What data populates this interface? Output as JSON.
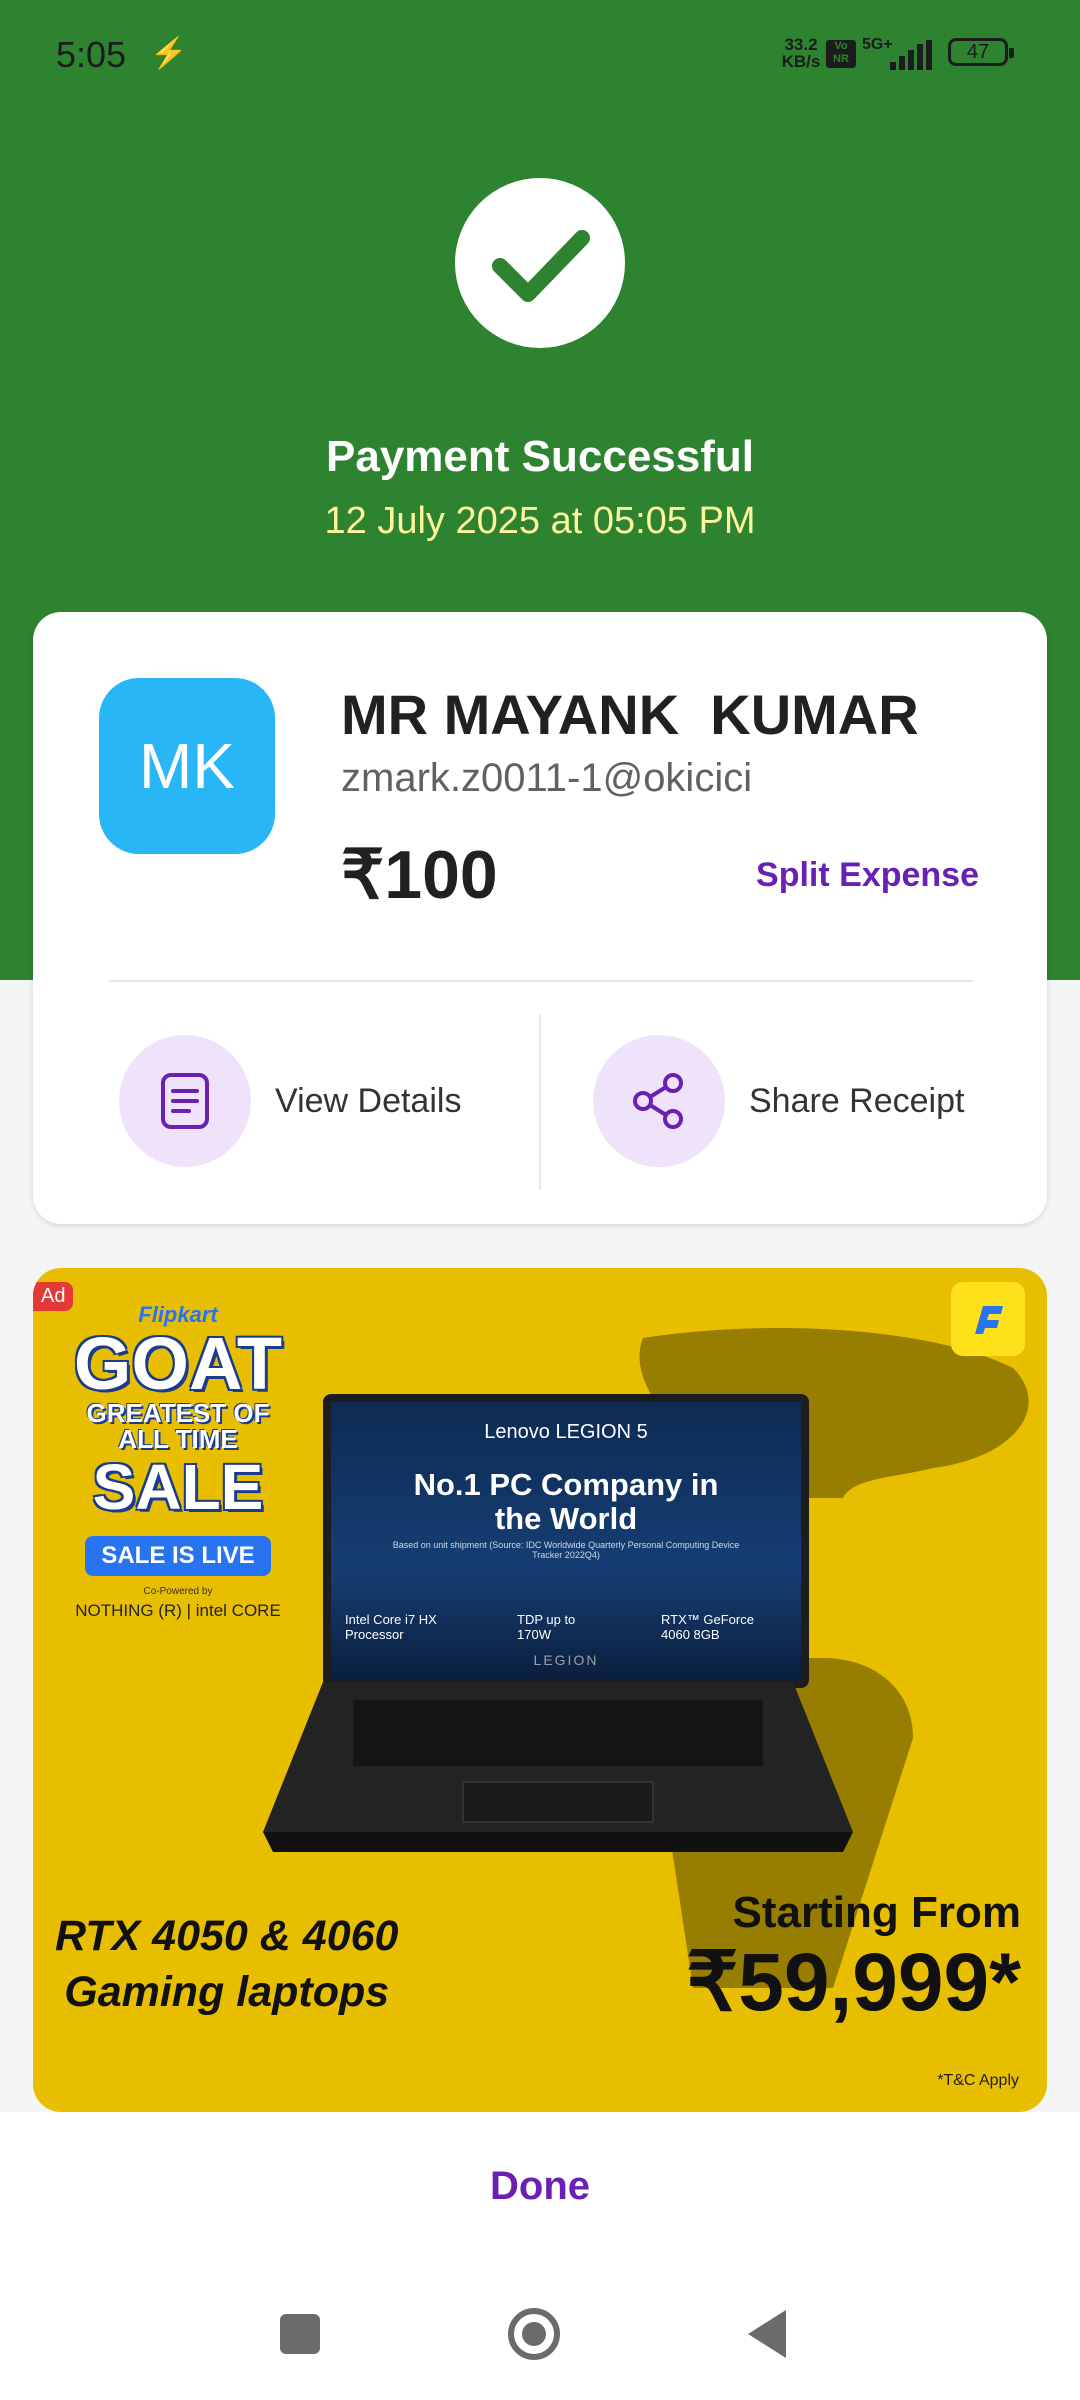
{
  "status_bar": {
    "time": "5:05",
    "network_speed": "33.2 KB/s",
    "volte": "Vo NR",
    "network_type": "5G+",
    "battery": "47",
    "icons": [
      "flash-icon",
      "signal-icon",
      "battery-icon"
    ]
  },
  "payment": {
    "title": "Payment Successful",
    "datetime": "12 July 2025 at 05:05 PM",
    "status_icon": "check-icon"
  },
  "recipient": {
    "initials": "MK",
    "name": "MR MAYANK  KUMAR",
    "upi_id": "zmark.z0011-1@okicici",
    "amount": "₹100",
    "split_label": "Split Expense"
  },
  "actions": [
    {
      "label": "View Details",
      "icon": "document-icon"
    },
    {
      "label": "Share Receipt",
      "icon": "share-icon"
    }
  ],
  "ad": {
    "badge": "Ad",
    "brand": "Flipkart",
    "goat": "GOAT",
    "goat_sub": "GREATEST OF ALL TIME",
    "sale": "SALE",
    "sale_live": "SALE IS LIVE",
    "co_powered": "Co-Powered by",
    "partners": "NOTHING (R) | intel CORE",
    "laptop_brand": "Lenovo LEGION 5",
    "headline": "No.1 PC Company in the World",
    "headline_source": "Based on unit shipment (Source: IDC Worldwide Quarterly Personal Computing Device Tracker 2022Q4)",
    "spec_cpu": "Intel Core i7 HX Processor",
    "spec_tdp": "TDP up to 170W",
    "spec_gpu": "RTX™ GeForce 4060 8GB",
    "legion_label": "LEGION",
    "left_line1": "RTX 4050 & 4060",
    "left_line2": "Gaming laptops",
    "starting_from": "Starting From",
    "price": "₹59,999*",
    "tnc": "*T&C Apply",
    "colors": {
      "background": "#e8bf00",
      "accent": "#2874f0"
    }
  },
  "footer": {
    "done_label": "Done"
  },
  "colors": {
    "success_green": "#2e8330",
    "purple_accent": "#6a1fb5",
    "avatar_blue": "#29b6f6"
  }
}
